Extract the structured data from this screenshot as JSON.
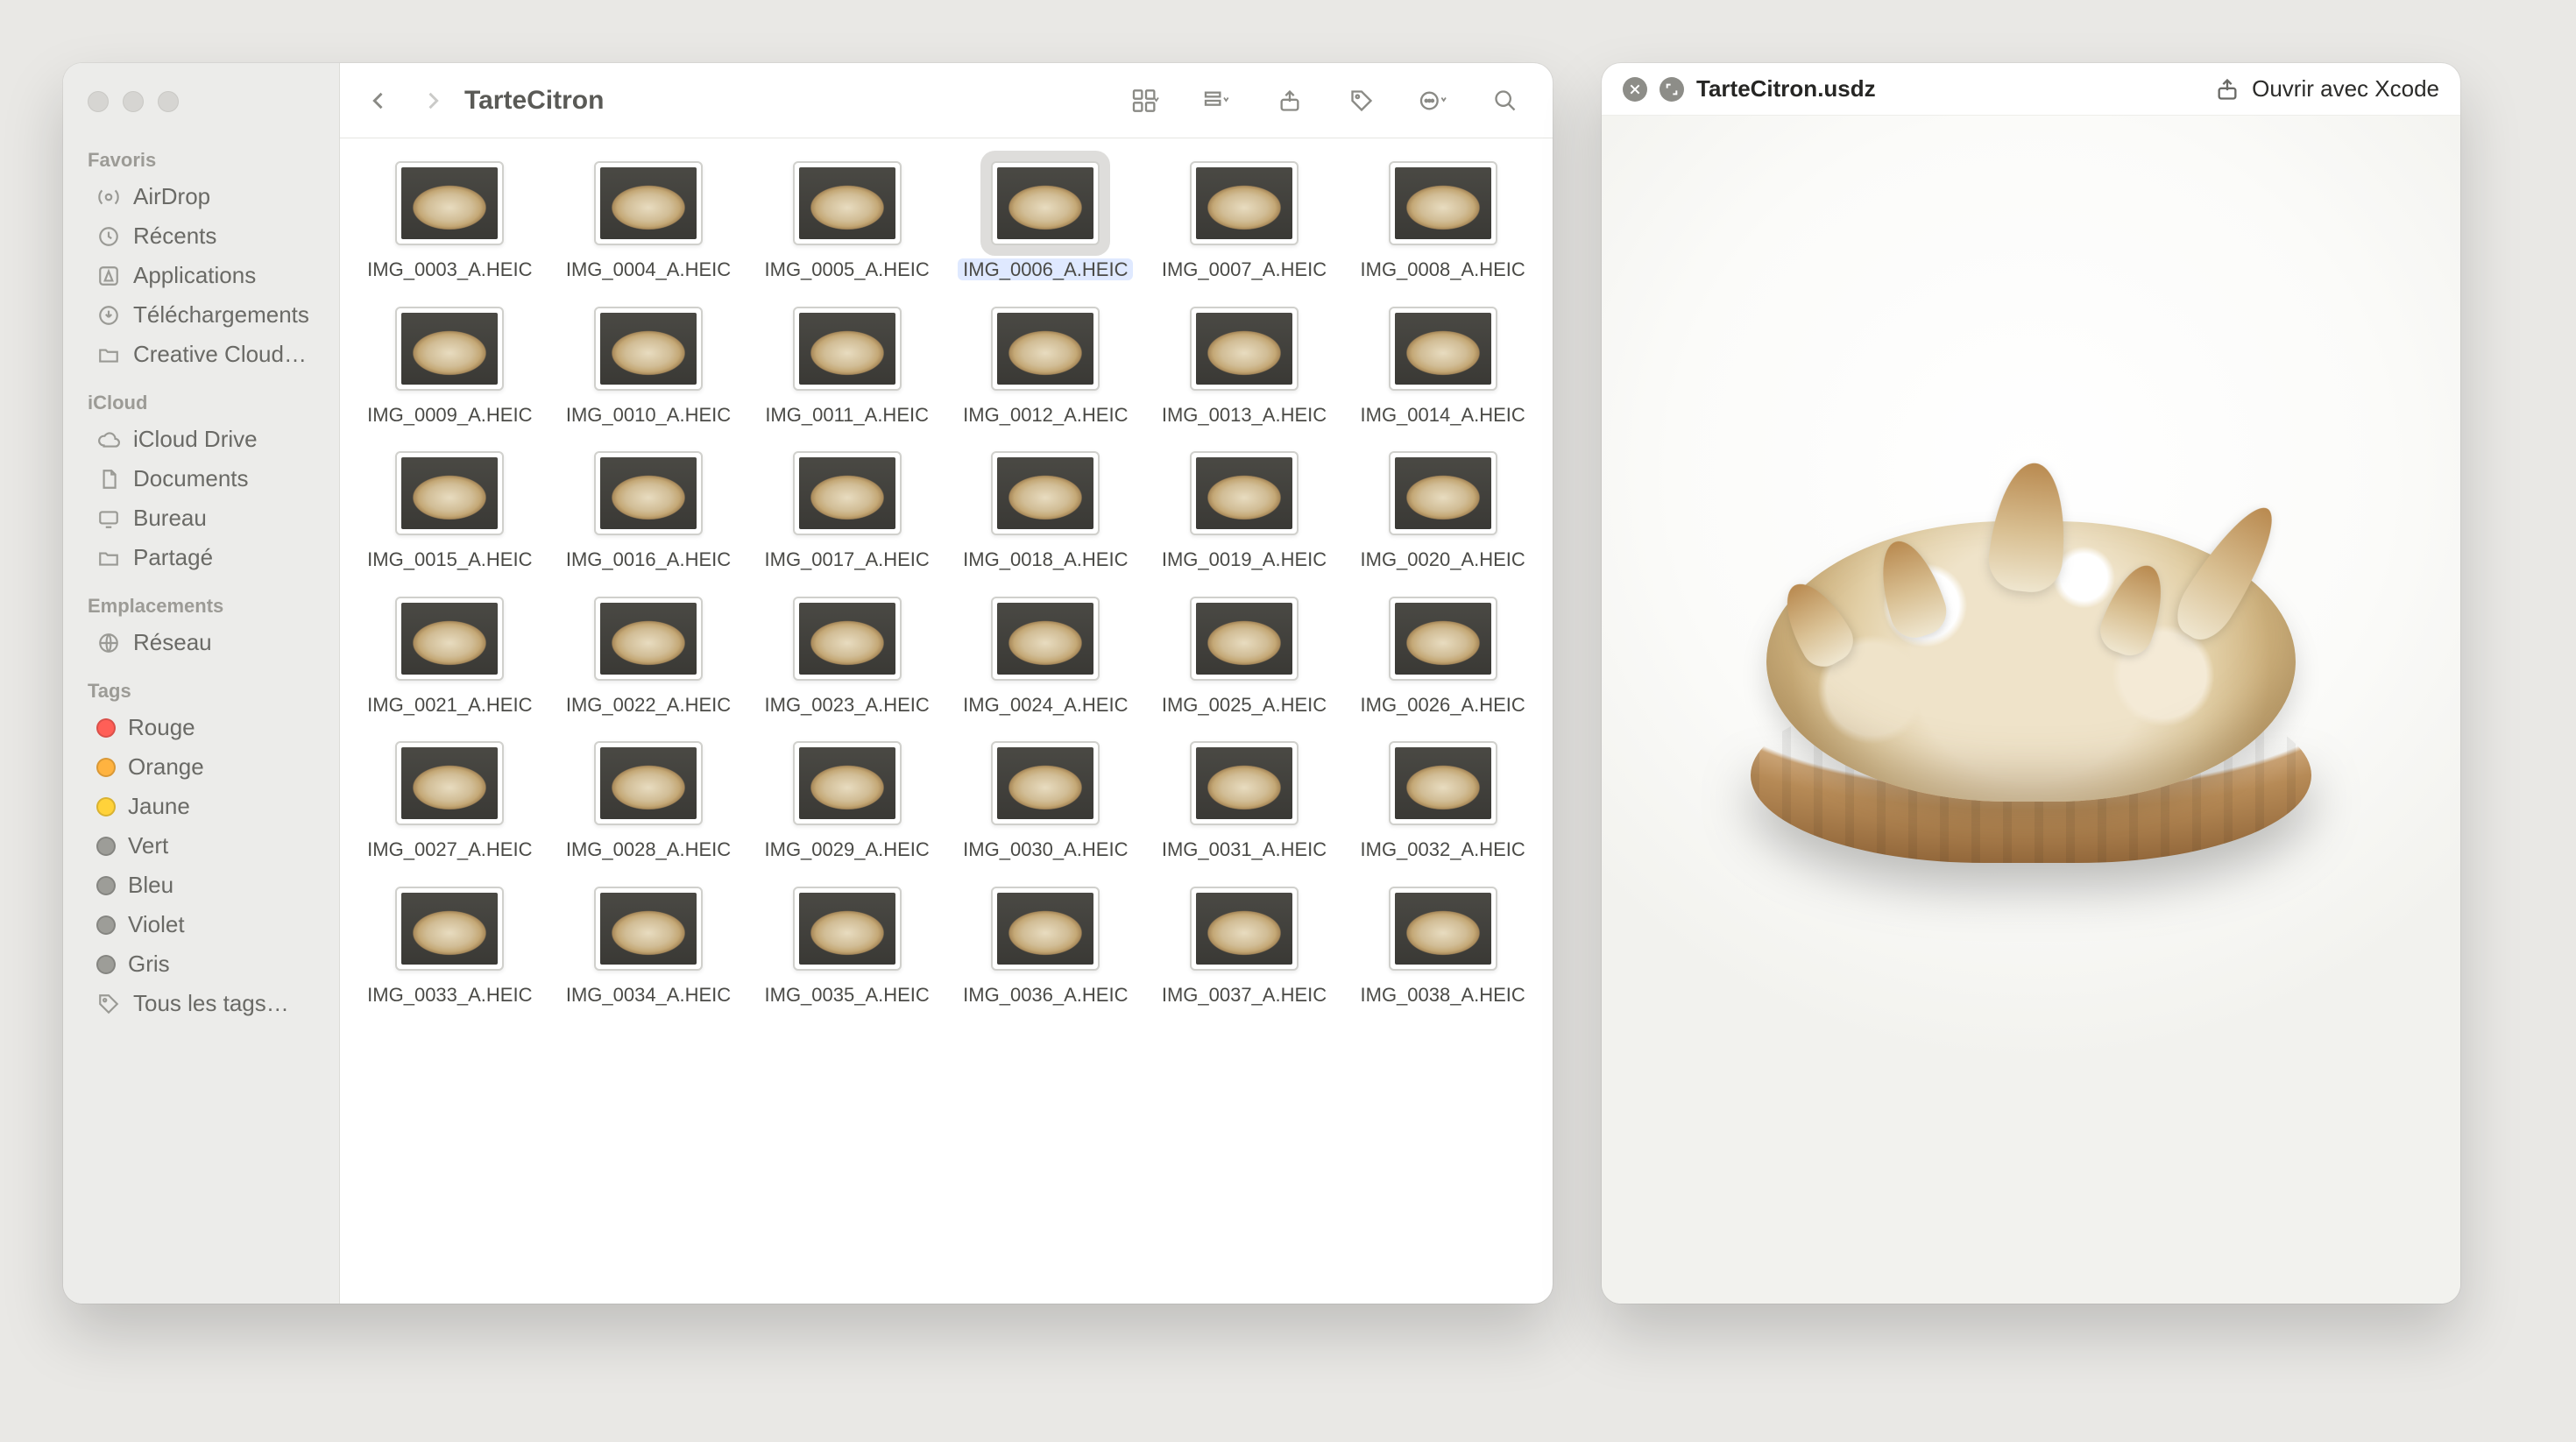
{
  "finder": {
    "title": "TarteCitron",
    "selected_file": "IMG_0006_A.HEIC",
    "files": [
      "IMG_0003_A.HEIC",
      "IMG_0004_A.HEIC",
      "IMG_0005_A.HEIC",
      "IMG_0006_A.HEIC",
      "IMG_0007_A.HEIC",
      "IMG_0008_A.HEIC",
      "IMG_0009_A.HEIC",
      "IMG_0010_A.HEIC",
      "IMG_0011_A.HEIC",
      "IMG_0012_A.HEIC",
      "IMG_0013_A.HEIC",
      "IMG_0014_A.HEIC",
      "IMG_0015_A.HEIC",
      "IMG_0016_A.HEIC",
      "IMG_0017_A.HEIC",
      "IMG_0018_A.HEIC",
      "IMG_0019_A.HEIC",
      "IMG_0020_A.HEIC",
      "IMG_0021_A.HEIC",
      "IMG_0022_A.HEIC",
      "IMG_0023_A.HEIC",
      "IMG_0024_A.HEIC",
      "IMG_0025_A.HEIC",
      "IMG_0026_A.HEIC",
      "IMG_0027_A.HEIC",
      "IMG_0028_A.HEIC",
      "IMG_0029_A.HEIC",
      "IMG_0030_A.HEIC",
      "IMG_0031_A.HEIC",
      "IMG_0032_A.HEIC",
      "IMG_0033_A.HEIC",
      "IMG_0034_A.HEIC",
      "IMG_0035_A.HEIC",
      "IMG_0036_A.HEIC",
      "IMG_0037_A.HEIC",
      "IMG_0038_A.HEIC"
    ]
  },
  "sidebar": {
    "sections": {
      "favoris": {
        "title": "Favoris",
        "items": [
          "AirDrop",
          "Récents",
          "Applications",
          "Téléchargements",
          "Creative Cloud…"
        ]
      },
      "icloud": {
        "title": "iCloud",
        "items": [
          "iCloud Drive",
          "Documents",
          "Bureau",
          "Partagé"
        ]
      },
      "emplacements": {
        "title": "Emplacements",
        "items": [
          "Réseau"
        ]
      },
      "tags": {
        "title": "Tags",
        "items": [
          {
            "label": "Rouge",
            "color": "#ff5f57"
          },
          {
            "label": "Orange",
            "color": "#ffb340"
          },
          {
            "label": "Jaune",
            "color": "#ffd23a"
          },
          {
            "label": "Vert",
            "color": "#9d9d98"
          },
          {
            "label": "Bleu",
            "color": "#9d9d98"
          },
          {
            "label": "Violet",
            "color": "#9d9d98"
          },
          {
            "label": "Gris",
            "color": "#9d9d98"
          }
        ],
        "all": "Tous les tags…"
      }
    }
  },
  "preview": {
    "title": "TarteCitron.usdz",
    "open_with": "Ouvrir avec Xcode"
  }
}
